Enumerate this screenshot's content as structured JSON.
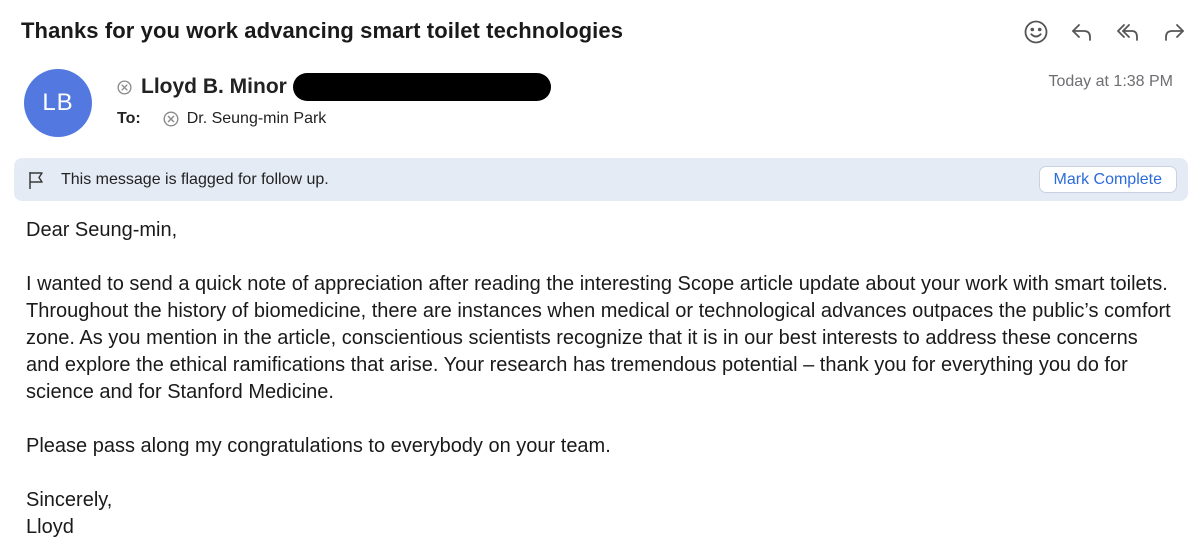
{
  "email": {
    "subject": "Thanks for you work advancing smart toilet technologies",
    "sender": {
      "initials": "LB",
      "name": "Lloyd B. Minor",
      "avatar_color": "#5379e0"
    },
    "timestamp": "Today at 1:38 PM",
    "to_label": "To:",
    "recipient": "Dr. Seung-min Park",
    "flag": {
      "text": "This message is flagged for follow up.",
      "button_label": "Mark Complete",
      "bar_color": "#e5ebf5",
      "button_text_color": "#2d6bd8"
    },
    "body": {
      "greeting": "Dear Seung-min,",
      "paragraph1": "I wanted to send a quick note of appreciation after reading the interesting Scope article update about your work with smart toilets. Throughout the history of biomedicine, there are instances when medical or technological advances outpaces the public’s comfort zone. As you mention in the article, conscientious scientists recognize that it is in our best interests to address these concerns and explore the ethical ramifications that arise. Your research has tremendous potential – thank you for everything you do for science and for Stanford Medicine.",
      "paragraph2": "Please pass along my congratulations to everybody on your team.",
      "closing": "Sincerely,",
      "signature": "Lloyd"
    }
  },
  "toolbar": {
    "icons": [
      "smiley-icon",
      "reply-icon",
      "reply-all-icon",
      "forward-icon"
    ]
  }
}
